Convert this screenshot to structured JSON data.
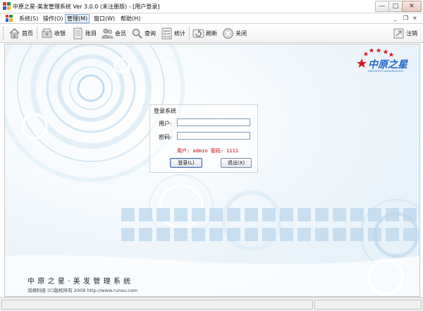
{
  "window": {
    "title": "中原之星-美发管理系统 Ver 3.0.0 (未注册版) - [用户登录]",
    "controls": {
      "minimize": "—",
      "maximize": "□",
      "close": "✕"
    }
  },
  "menubar": {
    "items": [
      {
        "label": "系统(S)"
      },
      {
        "label": "操作(O)"
      },
      {
        "label": "管理(M)"
      },
      {
        "label": "窗口(W)"
      },
      {
        "label": "帮助(H)"
      }
    ],
    "mdi": {
      "min": "_",
      "restore": "❐",
      "close": "×"
    }
  },
  "toolbar": {
    "home": "首页",
    "cashier": "收银",
    "accounts": "账目",
    "members": "会员",
    "query": "查询",
    "stats": "统计",
    "refresh": "刷新",
    "close": "关闭",
    "logout": "注销"
  },
  "logo": {
    "title": "中原之星",
    "subtitle": "ZHONGYUANZHIXING"
  },
  "brand": {
    "name": "中原之星·美发管理系统",
    "copyright": "润顺科技 (C)版权所有 2009  http://www.runsu.com"
  },
  "login": {
    "title": "登录系统",
    "user_label": "用户:",
    "password_label": "密码:",
    "user_value": "",
    "password_value": "",
    "hint": "用户: admin  密码: 1111",
    "login_button": "登录(L)",
    "exit_button": "退出(X)"
  },
  "colors": {
    "accent": "#1e66c8",
    "hint_red": "#c00000",
    "logo_star_red": "#d8141c"
  },
  "icons": [
    "app-icon",
    "home-icon",
    "cashier-icon",
    "accounts-icon",
    "members-icon",
    "query-icon",
    "stats-icon",
    "refresh-icon",
    "close-circle-icon",
    "logout-icon",
    "star-icon"
  ]
}
